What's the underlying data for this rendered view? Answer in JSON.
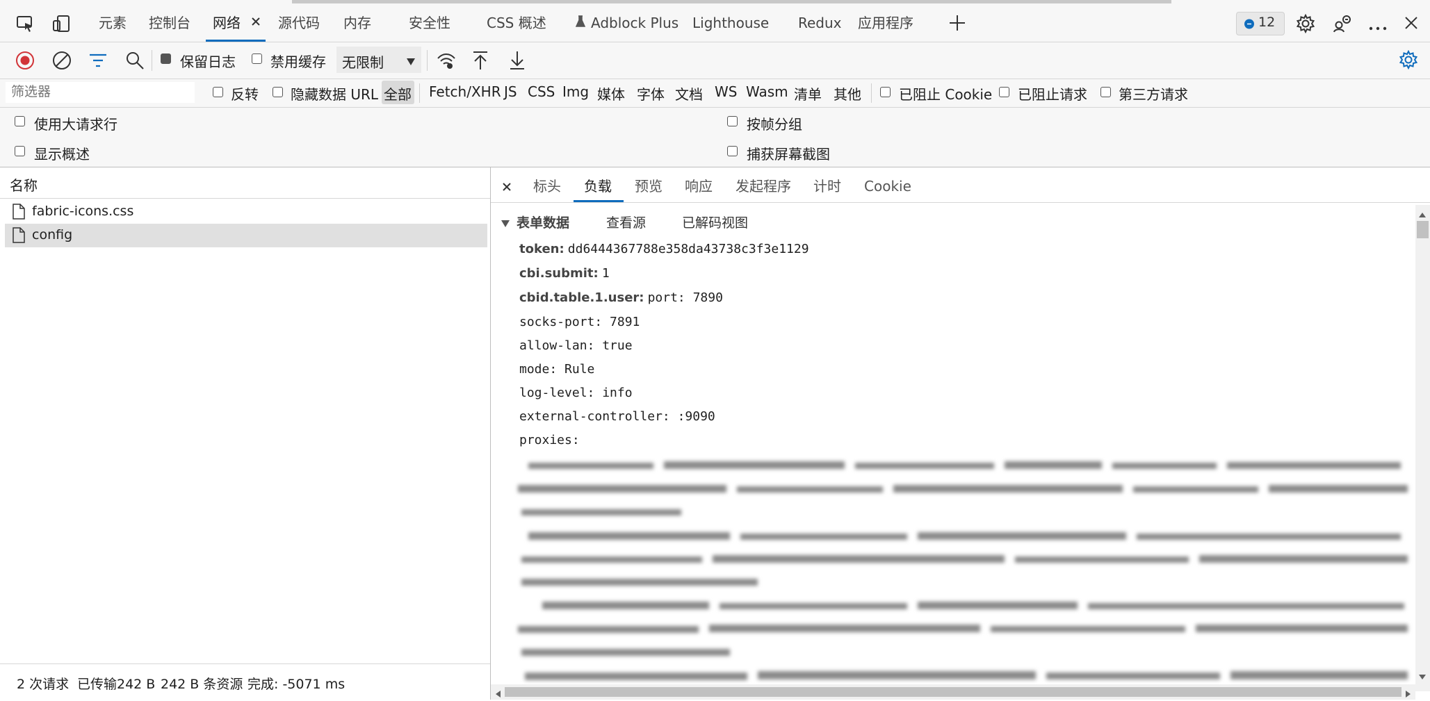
{
  "devtools": {
    "tabs": [
      {
        "label": "元素"
      },
      {
        "label": "控制台"
      },
      {
        "label": "网络"
      },
      {
        "label": "源代码"
      },
      {
        "label": "内存"
      },
      {
        "label": "安全性"
      },
      {
        "label": "CSS 概述"
      },
      {
        "label": "Adblock Plus"
      },
      {
        "label": "Lighthouse"
      },
      {
        "label": "Redux"
      },
      {
        "label": "应用程序"
      }
    ],
    "active_tab": "网络",
    "issues_count": "12"
  },
  "toolbar": {
    "preserve_log_label": "保留日志",
    "disable_cache_label": "禁用缓存",
    "throttling_value": "无限制"
  },
  "filter_bar": {
    "placeholder": "筛选器",
    "invert_label": "反转",
    "hide_data_urls_label": "隐藏数据 URL",
    "types": [
      "全部",
      "Fetch/XHR",
      "JS",
      "CSS",
      "Img",
      "媒体",
      "字体",
      "文档",
      "WS",
      "Wasm",
      "清单",
      "其他"
    ],
    "blocked_cookies_label": "已阻止 Cookie",
    "blocked_requests_label": "已阻止请求",
    "third_party_label": "第三方请求"
  },
  "options": {
    "large_rows_label": "使用大请求行",
    "overview_label": "显示概述",
    "group_by_frame_label": "按帧分组",
    "capture_screenshots_label": "捕获屏幕截图"
  },
  "requests": {
    "column_name": "名称",
    "items": [
      {
        "name": "fabric-icons.css"
      },
      {
        "name": "config"
      }
    ],
    "summary": {
      "requests": "2 次请求",
      "transferred": "已传输242 B",
      "resources": "242 B 条资源",
      "finish": "完成: -5071 ms"
    }
  },
  "details": {
    "tabs": [
      "标头",
      "负载",
      "预览",
      "响应",
      "发起程序",
      "计时",
      "Cookie"
    ],
    "active_tab": "负载",
    "section_title": "表单数据",
    "view_source": "查看源",
    "view_decoded": "已解码视图",
    "fields": {
      "token_key": "token:",
      "token_val": "dd6444367788e358da43738c3f3e1129",
      "submit_key": "cbi.submit:",
      "submit_val": "1",
      "user_key": "cbid.table.1.user:",
      "user_val": "port: 7890"
    },
    "lines": [
      "socks-port: 7891",
      "allow-lan: true",
      "mode: Rule",
      "log-level: info",
      "external-controller: :9090",
      "proxies:"
    ]
  }
}
